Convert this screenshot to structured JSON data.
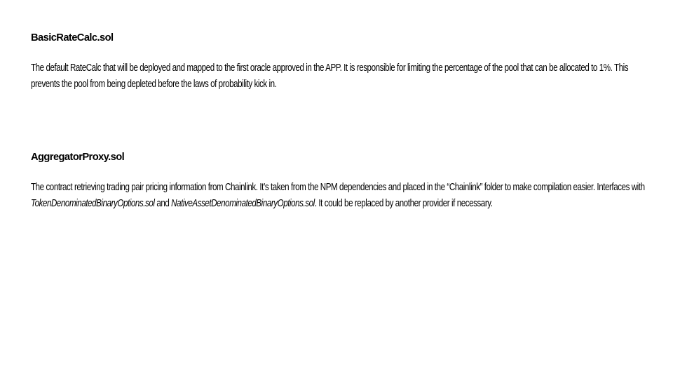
{
  "sections": [
    {
      "title": "BasicRateCalc.sol",
      "body": "The default RateCalc that will be deployed and mapped to the first oracle approved in the APP. It is responsible for limiting the percentage of the pool that can be allocated to 1%. This prevents the pool from being depleted before the laws of probability kick in."
    },
    {
      "title": "AggregatorProxy.sol",
      "body_part1": "The contract retrieving trading pair pricing information from Chainlink. It’s taken from the NPM dependencies and placed in the “Chainlink” folder to make compilation easier. Interfaces with ",
      "body_italic1": "TokenDenominatedBinaryOptions.sol",
      "body_part2": " and ",
      "body_italic2": "NativeAssetDenominatedBinaryOptions.sol",
      "body_part3": ". It could be replaced by another provider if necessary."
    }
  ]
}
